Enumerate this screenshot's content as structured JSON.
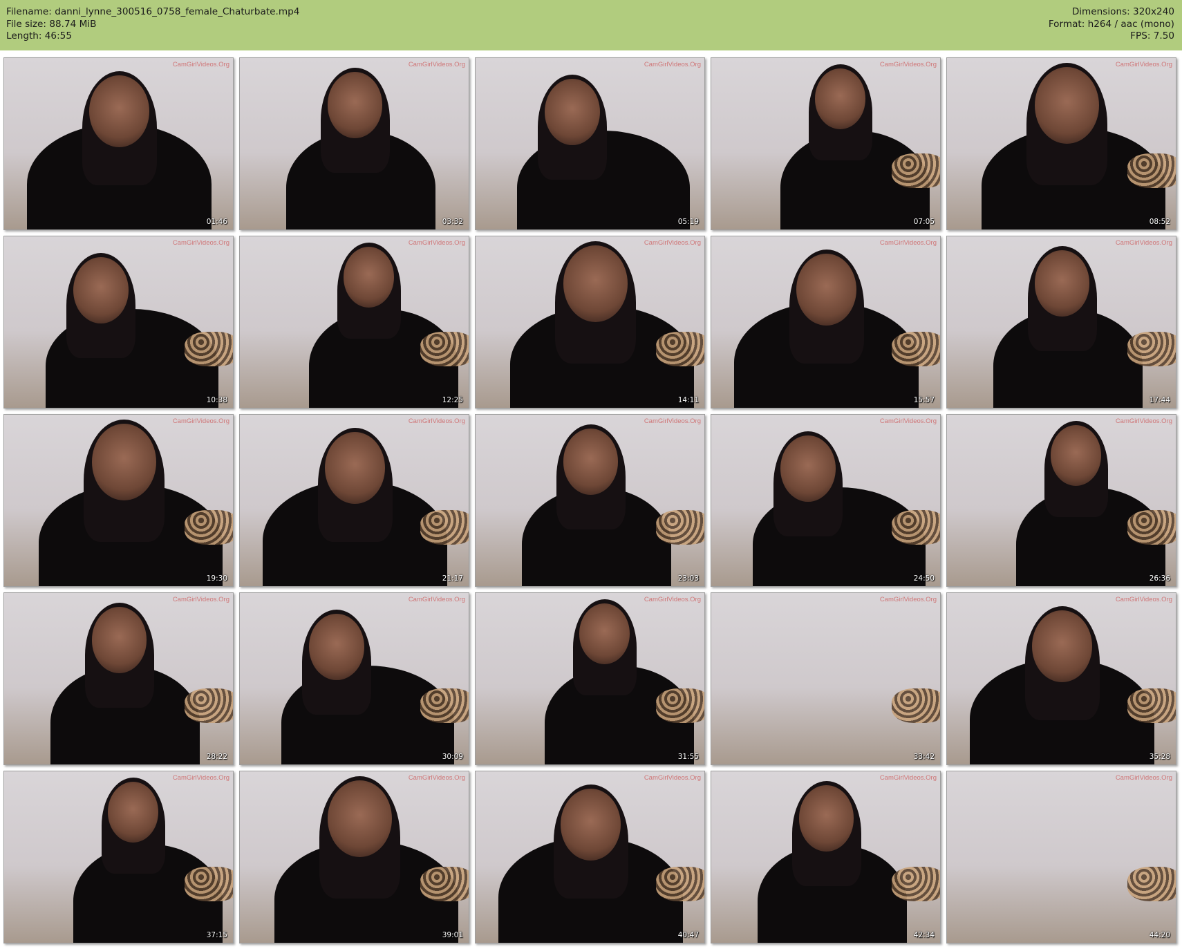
{
  "header": {
    "filename": "Filename: danni_lynne_300516_0758_female_Chaturbate.mp4",
    "filesize": "File size: 88.74 MiB",
    "length": "Length: 46:55",
    "dimensions": "Dimensions: 320x240",
    "format": "Format: h264 / aac (mono)",
    "fps": "FPS: 7.50",
    "background": "#b1cc7e"
  },
  "watermark": "CamGirlVideos.Org",
  "thumbnails": [
    {
      "timestamp": "01:46"
    },
    {
      "timestamp": "03:32"
    },
    {
      "timestamp": "05:19"
    },
    {
      "timestamp": "07:05"
    },
    {
      "timestamp": "08:52"
    },
    {
      "timestamp": "10:38"
    },
    {
      "timestamp": "12:25"
    },
    {
      "timestamp": "14:11"
    },
    {
      "timestamp": "15:57"
    },
    {
      "timestamp": "17:44"
    },
    {
      "timestamp": "19:30"
    },
    {
      "timestamp": "21:17"
    },
    {
      "timestamp": "23:03"
    },
    {
      "timestamp": "24:50"
    },
    {
      "timestamp": "26:36"
    },
    {
      "timestamp": "28:22"
    },
    {
      "timestamp": "30:09"
    },
    {
      "timestamp": "31:55"
    },
    {
      "timestamp": "33:42"
    },
    {
      "timestamp": "35:28"
    },
    {
      "timestamp": "37:15"
    },
    {
      "timestamp": "39:01"
    },
    {
      "timestamp": "40:47"
    },
    {
      "timestamp": "42:34"
    },
    {
      "timestamp": "44:20"
    }
  ]
}
